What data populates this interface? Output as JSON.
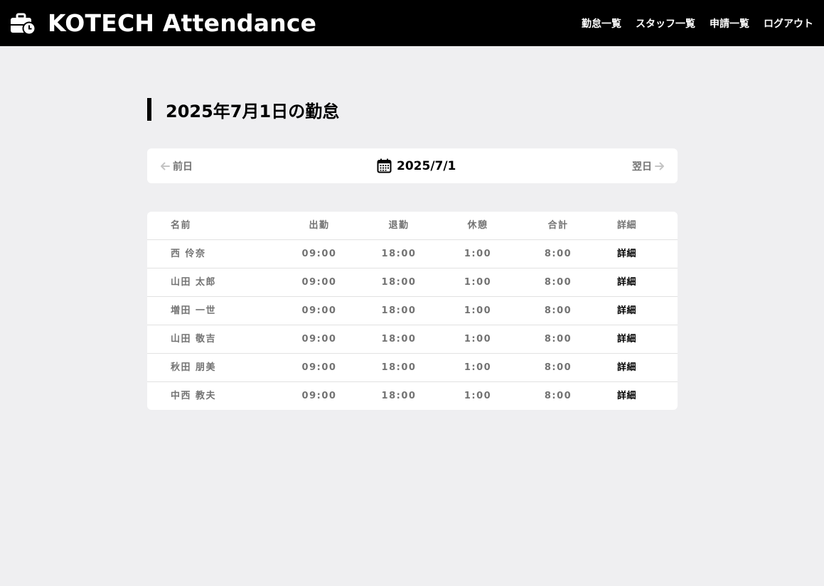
{
  "header": {
    "title": "KOTECH Attendance",
    "logo_icon": "briefcase-clock-icon",
    "nav": [
      {
        "label": "勤怠一覧"
      },
      {
        "label": "スタッフ一覧"
      },
      {
        "label": "申請一覧"
      },
      {
        "label": "ログアウト"
      }
    ]
  },
  "page": {
    "title": "2025年7月1日の勤怠"
  },
  "date_nav": {
    "prev_label": "前日",
    "current_date": "2025/7/1",
    "next_label": "翌日",
    "calendar_icon": "calendar-icon"
  },
  "table": {
    "headers": {
      "name": "名前",
      "clock_in": "出勤",
      "clock_out": "退勤",
      "break": "休憩",
      "total": "合計",
      "detail": "詳細"
    },
    "rows": [
      {
        "name": "西 伶奈",
        "clock_in": "09:00",
        "clock_out": "18:00",
        "break": "1:00",
        "total": "8:00",
        "detail": "詳細"
      },
      {
        "name": "山田 太郎",
        "clock_in": "09:00",
        "clock_out": "18:00",
        "break": "1:00",
        "total": "8:00",
        "detail": "詳細"
      },
      {
        "name": "増田 一世",
        "clock_in": "09:00",
        "clock_out": "18:00",
        "break": "1:00",
        "total": "8:00",
        "detail": "詳細"
      },
      {
        "name": "山田 敬吉",
        "clock_in": "09:00",
        "clock_out": "18:00",
        "break": "1:00",
        "total": "8:00",
        "detail": "詳細"
      },
      {
        "name": "秋田 朋美",
        "clock_in": "09:00",
        "clock_out": "18:00",
        "break": "1:00",
        "total": "8:00",
        "detail": "詳細"
      },
      {
        "name": "中西 教夫",
        "clock_in": "09:00",
        "clock_out": "18:00",
        "break": "1:00",
        "total": "8:00",
        "detail": "詳細"
      }
    ]
  },
  "colors": {
    "header_bg": "#000000",
    "page_bg": "#efeff1",
    "muted_text": "#737373"
  }
}
